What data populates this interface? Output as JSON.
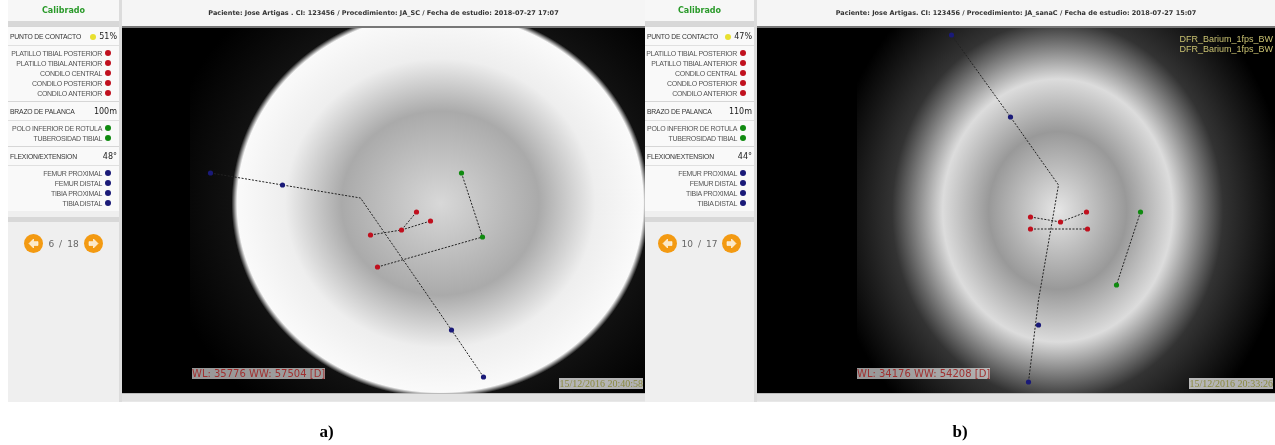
{
  "panels": [
    {
      "calibration": "Calibrado",
      "header": "Paciente: Jose  Artigas . CI:  123456 / Procedimiento: JA_SC / Fecha de estudio: 2018-07-27 17:07",
      "groups": [
        {
          "title": "PUNTO DE CONTACTO",
          "value": "51%",
          "indicator": true,
          "items": [
            {
              "label": "PLATILLO TIBIAL POSTERIOR",
              "color": "#c0101e"
            },
            {
              "label": "PLATILLO TIBIAL ANTERIOR",
              "color": "#c0101e"
            },
            {
              "label": "CONDILO CENTRAL",
              "color": "#c0101e"
            },
            {
              "label": "CONDILO POSTERIOR",
              "color": "#c0101e"
            },
            {
              "label": "CONDILO ANTERIOR",
              "color": "#c0101e"
            }
          ]
        },
        {
          "title": "BRAZO DE PALANCA",
          "value": "100m",
          "items": [
            {
              "label": "POLO INFERIOR DE ROTULA",
              "color": "#108a10"
            },
            {
              "label": "TUBEROSIDAD TIBIAL",
              "color": "#108a10"
            }
          ]
        },
        {
          "title": "FLEXION/EXTENSION",
          "value": "48°",
          "items": [
            {
              "label": "FEMUR PROXIMAL",
              "color": "#1a1a78"
            },
            {
              "label": "FEMUR DISTAL",
              "color": "#1a1a78"
            },
            {
              "label": "TIBIA PROXIMAL",
              "color": "#1a1a78"
            },
            {
              "label": "TIBIA DISTAL",
              "color": "#1a1a78"
            }
          ]
        }
      ],
      "pager": {
        "current": "6",
        "separator": "/",
        "total": "18"
      },
      "window_level": "WL: 35776 WW: 57504 [D]",
      "timestamp": "15/12/2016 20:40:58",
      "caption": "a)"
    },
    {
      "calibration": "Calibrado",
      "header": "Paciente: Jose Artigas. CI:  123456 / Procedimiento: JA_sanaC / Fecha de estudio: 2018-07-27 15:07",
      "groups": [
        {
          "title": "PUNTO DE CONTACTO",
          "value": "47%",
          "indicator": true,
          "items": [
            {
              "label": "PLATILLO TIBIAL POSTERIOR",
              "color": "#c0101e"
            },
            {
              "label": "PLATILLO TIBIAL ANTERIOR",
              "color": "#c0101e"
            },
            {
              "label": "CONDILO CENTRAL",
              "color": "#c0101e"
            },
            {
              "label": "CONDILO POSTERIOR",
              "color": "#c0101e"
            },
            {
              "label": "CONDILO ANTERIOR",
              "color": "#c0101e"
            }
          ]
        },
        {
          "title": "BRAZO DE PALANCA",
          "value": "110m",
          "items": [
            {
              "label": "POLO INFERIOR DE ROTULA",
              "color": "#108a10"
            },
            {
              "label": "TUBEROSIDAD TIBIAL",
              "color": "#108a10"
            }
          ]
        },
        {
          "title": "FLEXION/EXTENSION",
          "value": "44°",
          "items": [
            {
              "label": "FEMUR PROXIMAL",
              "color": "#1a1a78"
            },
            {
              "label": "FEMUR DISTAL",
              "color": "#1a1a78"
            },
            {
              "label": "TIBIA PROXIMAL",
              "color": "#1a1a78"
            },
            {
              "label": "TIBIA DISTAL",
              "color": "#1a1a78"
            }
          ]
        }
      ],
      "pager": {
        "current": "10",
        "separator": "/",
        "total": "17"
      },
      "image_labels": [
        "DFR_Barium_1fps_BW",
        "DFR_Barium_1fps_BW"
      ],
      "window_level": "WL: 34176 WW: 54208 [D]",
      "timestamp": "15/12/2016 20:33:26",
      "caption": "b)"
    }
  ]
}
